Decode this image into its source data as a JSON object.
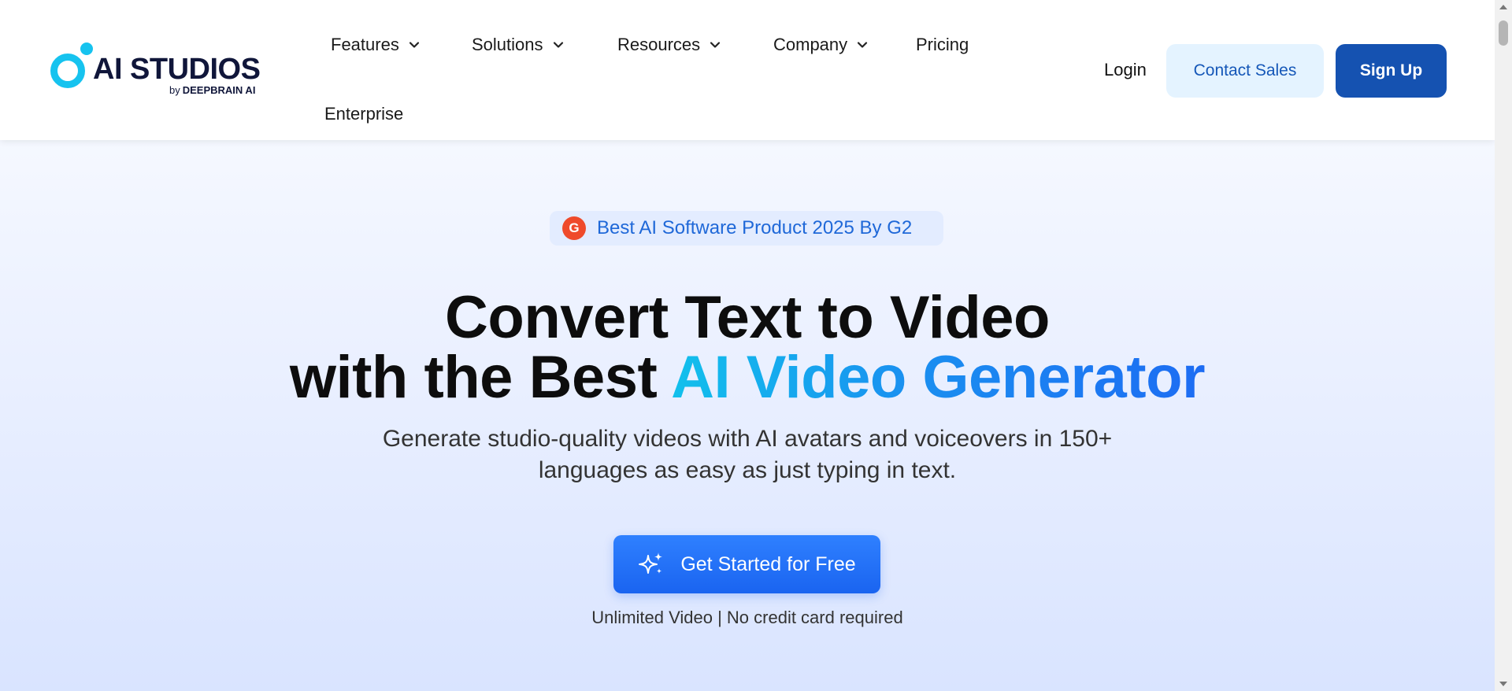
{
  "logo": {
    "wordmark": "AI STUDIOS",
    "by": "by",
    "byline": "DEEPBRAIN AI"
  },
  "nav": {
    "items": [
      {
        "label": "Features",
        "has_dropdown": true
      },
      {
        "label": "Solutions",
        "has_dropdown": true
      },
      {
        "label": "Resources",
        "has_dropdown": true
      },
      {
        "label": "Company",
        "has_dropdown": true
      },
      {
        "label": "Pricing",
        "has_dropdown": false
      },
      {
        "label": "Enterprise",
        "has_dropdown": false
      }
    ],
    "login": "Login",
    "contact_sales": "Contact Sales",
    "sign_up": "Sign Up"
  },
  "hero": {
    "badge": {
      "icon_text": "G",
      "icon": "g2-logo-icon",
      "text": "Best AI Software Product 2025 By G2"
    },
    "headline_line1": "Convert Text to Video",
    "headline_line2_prefix": "with the Best ",
    "headline_line2_highlight": "AI Video Generator",
    "subtext_line1": "Generate studio-quality videos with AI avatars and voiceovers in 150+",
    "subtext_line2": "languages as easy as just typing in text.",
    "cta": {
      "label": "Get Started for Free",
      "icon": "sparkle-icon"
    },
    "note": "Unlimited Video | No credit card required"
  },
  "colors": {
    "brand_cyan": "#16c3ef",
    "brand_navy": "#10163a",
    "primary_blue": "#1552b1",
    "cta_blue": "#2f80ff",
    "badge_bg": "#e3ecff",
    "g2_red": "#ef4a2b"
  }
}
